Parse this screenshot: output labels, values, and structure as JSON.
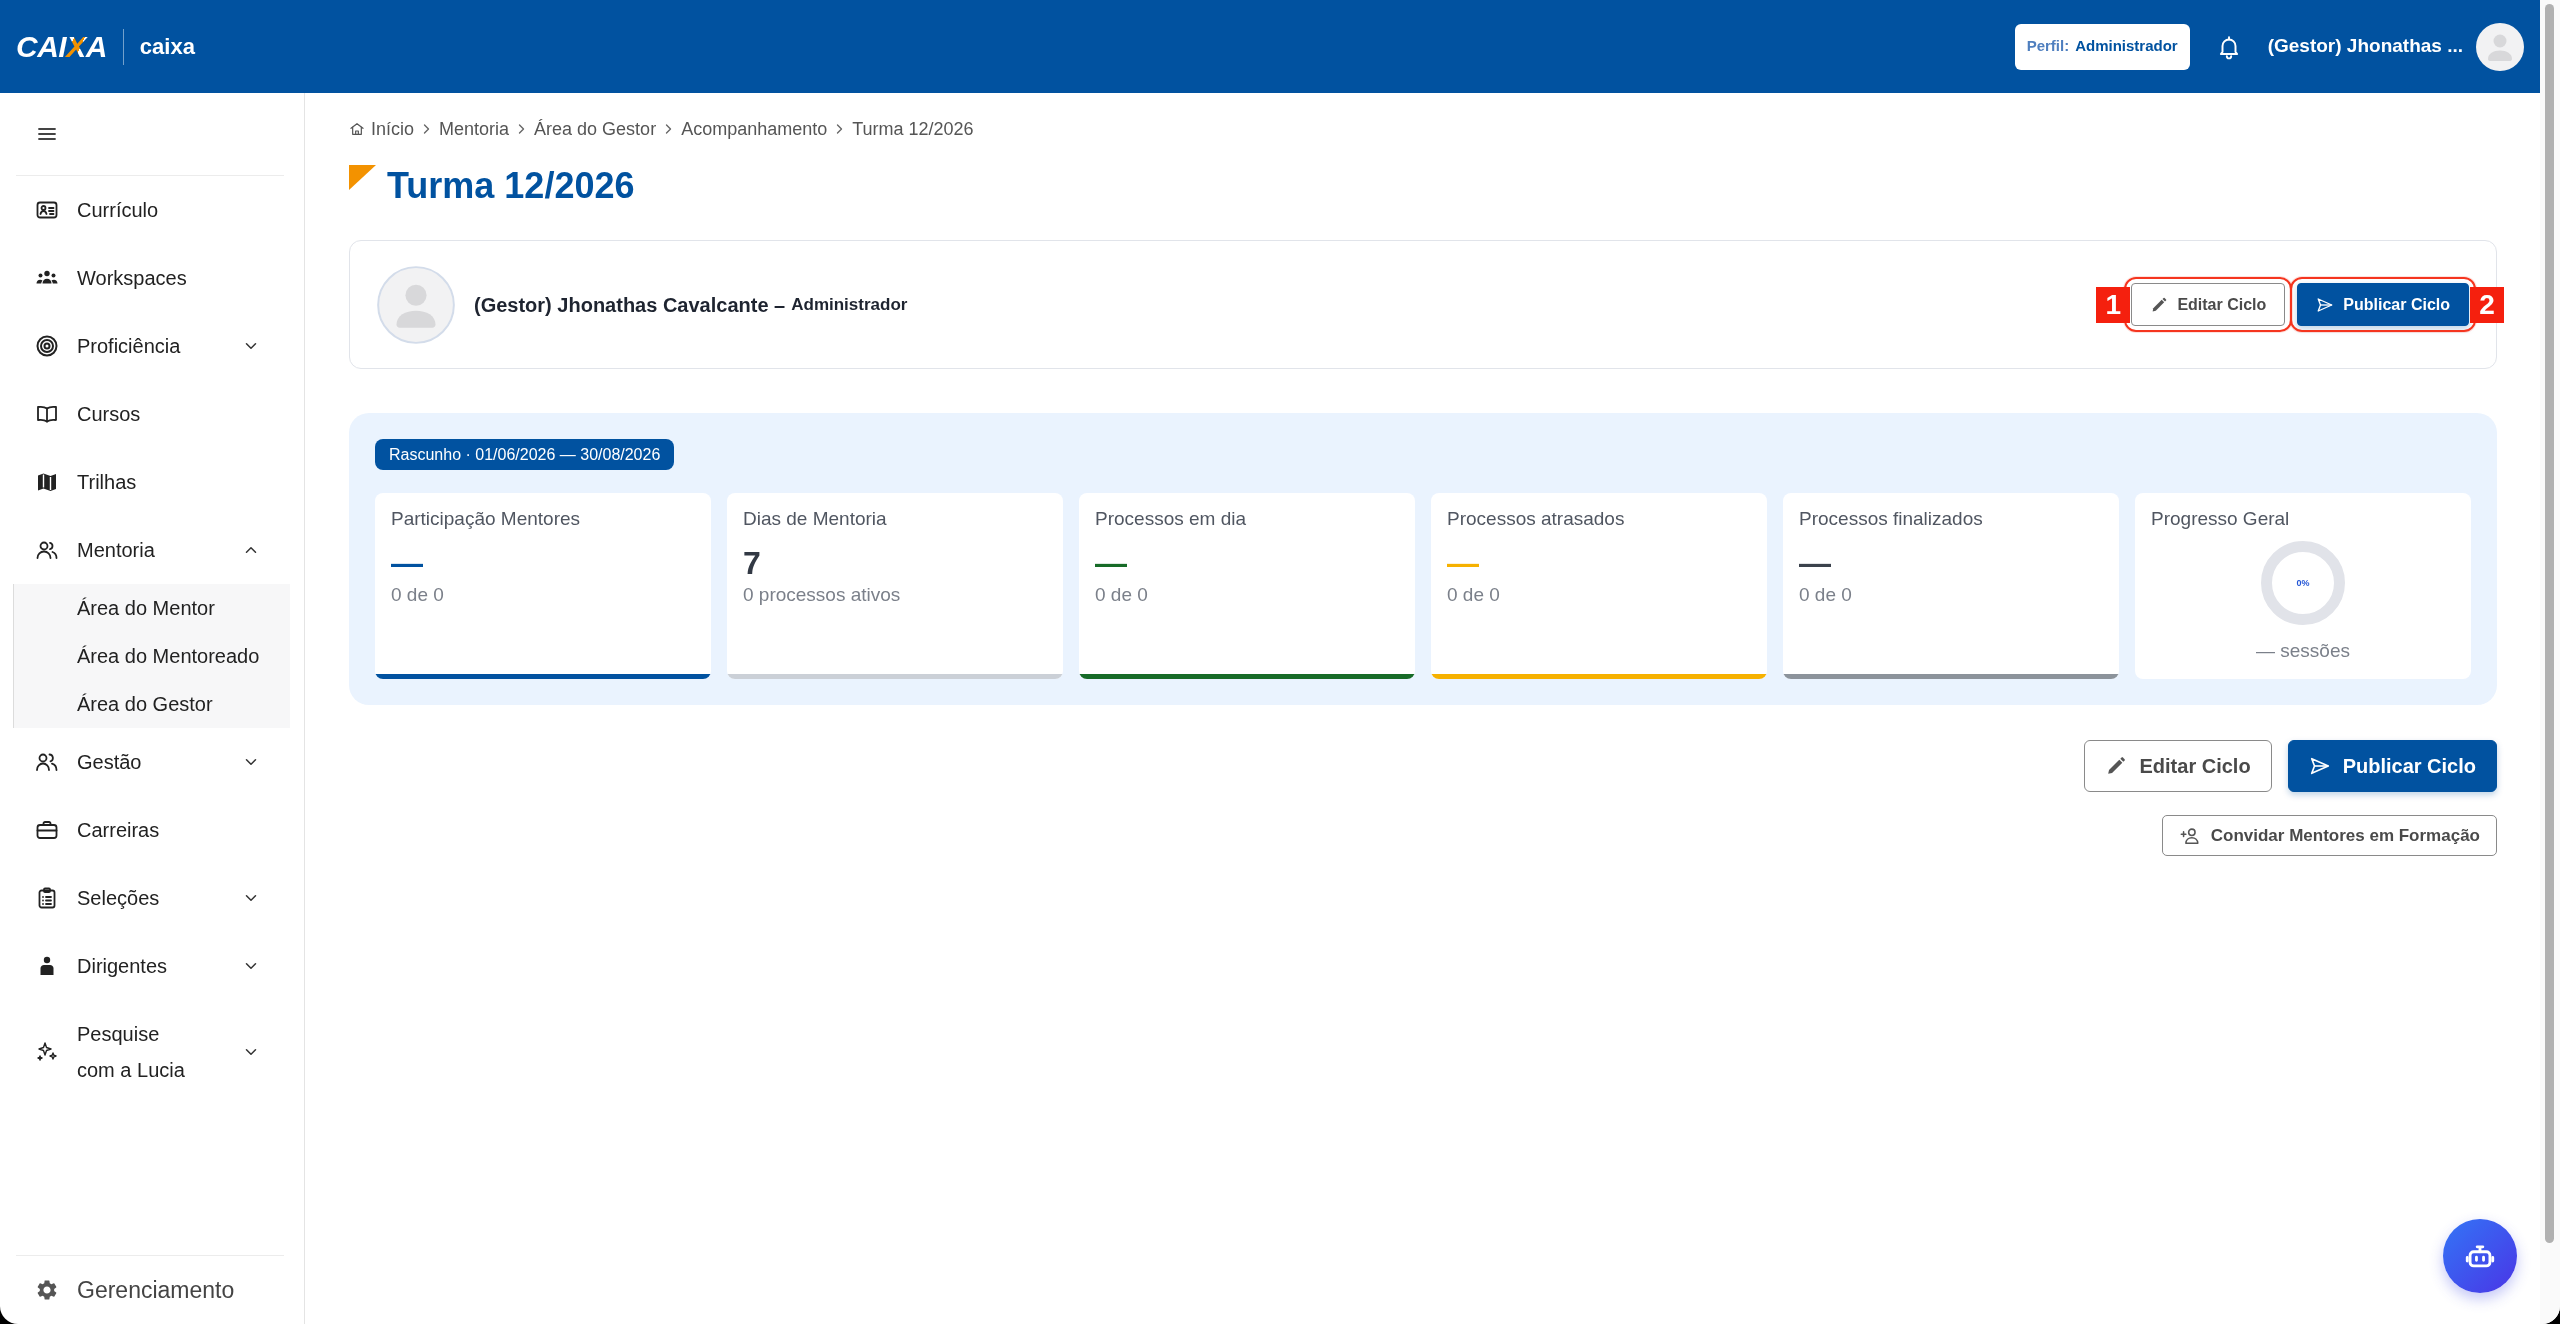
{
  "header": {
    "logo": "CAIXA",
    "brand": "caixa",
    "profile": {
      "label": "Perfil:",
      "value": "Administrador"
    },
    "user_name": "(Gestor) Jhonathas ..."
  },
  "sidebar": {
    "items": [
      {
        "label": "Currículo"
      },
      {
        "label": "Workspaces"
      },
      {
        "label": "Proficiência",
        "expanded": false
      },
      {
        "label": "Cursos"
      },
      {
        "label": "Trilhas"
      },
      {
        "label": "Mentoria",
        "expanded": true,
        "children": [
          {
            "label": "Área do Mentor"
          },
          {
            "label": "Área do Mentoreado"
          },
          {
            "label": "Área do Gestor"
          }
        ]
      },
      {
        "label": "Gestão",
        "expanded": false
      },
      {
        "label": "Carreiras"
      },
      {
        "label": "Seleções",
        "expanded": false
      },
      {
        "label": "Dirigentes",
        "expanded": false
      },
      {
        "label": "Pesquise com a Lucia",
        "expanded": false
      }
    ],
    "footer": {
      "label": "Gerenciamento"
    }
  },
  "breadcrumb": [
    "Início",
    "Mentoria",
    "Área do Gestor",
    "Acompanhamento",
    "Turma 12/2026"
  ],
  "page_title": "Turma 12/2026",
  "profile_card": {
    "name": "(Gestor) Jhonathas Cavalcante –",
    "role": "Administrador",
    "actions": [
      {
        "label": "Editar Ciclo",
        "kind": "outline",
        "callout": "1"
      },
      {
        "label": "Publicar Ciclo",
        "kind": "primary",
        "callout": "2"
      }
    ]
  },
  "stats": {
    "badge": "Rascunho · 01/06/2026 — 30/08/2026",
    "cards": [
      {
        "kind": "stat",
        "title": "Participação Mentores",
        "value": {
          "text": "—",
          "color": "#0152a0"
        },
        "caption": "0 de 0",
        "color": "#0152a0"
      },
      {
        "kind": "stat",
        "title": "Dias de Mentoria",
        "value": {
          "text": "7",
          "color": "#323944"
        },
        "caption": "0 processos ativos",
        "color": "#cbd0d7"
      },
      {
        "kind": "stat",
        "title": "Processos em dia",
        "value": {
          "text": "—",
          "color": "#176b28"
        },
        "caption": "0 de 0",
        "color": "#176b28"
      },
      {
        "kind": "stat",
        "title": "Processos atrasados",
        "value": {
          "text": "—",
          "color": "#f6b100"
        },
        "caption": "0 de 0",
        "color": "#f6b100"
      },
      {
        "kind": "stat",
        "title": "Processos finalizados",
        "value": {
          "text": "—",
          "color": "#3b424c"
        },
        "caption": "0 de 0",
        "color": "#8c939b"
      },
      {
        "kind": "progress",
        "title": "Progresso Geral",
        "percent": "0%",
        "caption": "— sessões"
      }
    ]
  },
  "actions": [
    {
      "label": "Editar Ciclo",
      "kind": "outline"
    },
    {
      "label": "Publicar Ciclo",
      "kind": "primary"
    }
  ],
  "invite_button": {
    "label": "Convidar Mentores em Formação"
  }
}
